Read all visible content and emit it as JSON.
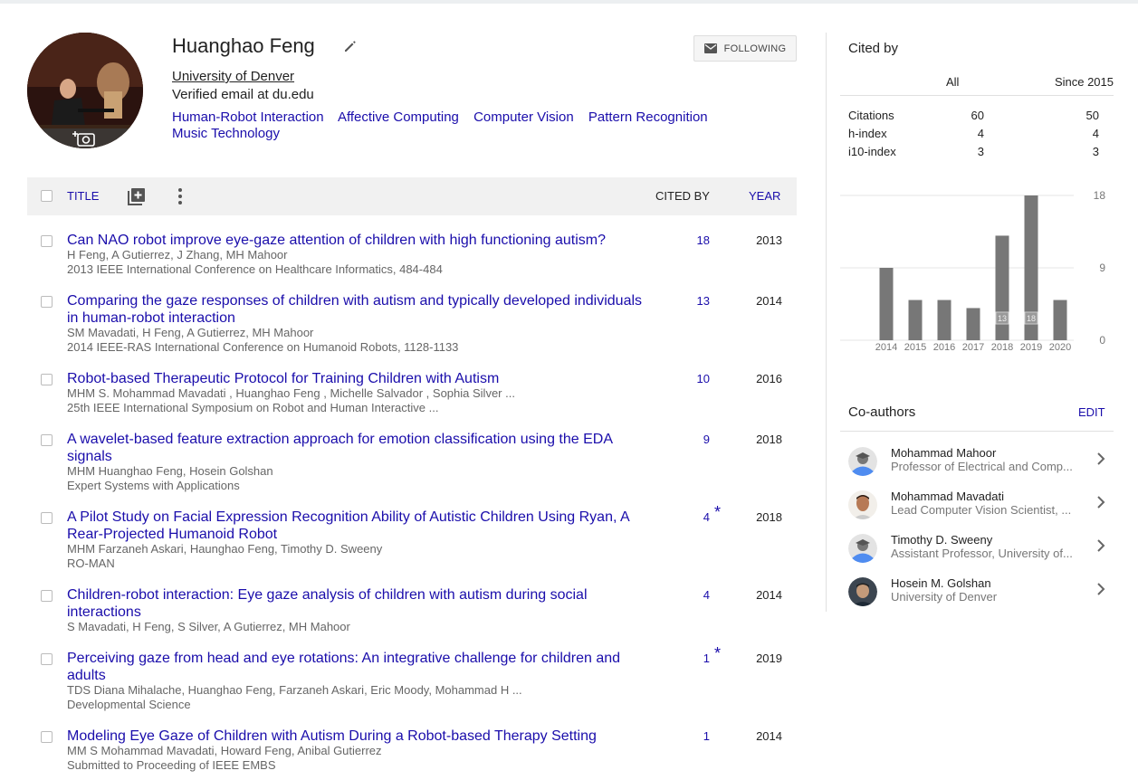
{
  "profile": {
    "name": "Huanghao Feng",
    "affiliation": "University of Denver",
    "email": "Verified email at du.edu",
    "interests": [
      "Human-Robot Interaction",
      "Affective Computing",
      "Computer Vision",
      "Pattern Recognition",
      "Music Technology"
    ],
    "follow_label": "FOLLOWING"
  },
  "table": {
    "headers": {
      "title": "TITLE",
      "cited_by": "CITED BY",
      "year": "YEAR"
    },
    "rows": [
      {
        "title": "Can NAO robot improve eye-gaze attention of children with high functioning autism?",
        "authors": "H Feng, A Gutierrez, J Zhang, MH Mahoor",
        "venue": "2013 IEEE International Conference on Healthcare Informatics, 484-484",
        "cites": "18",
        "star": "",
        "year": "2013"
      },
      {
        "title": "Comparing the gaze responses of children with autism and typically developed individuals in human-robot interaction",
        "authors": "SM Mavadati, H Feng, A Gutierrez, MH Mahoor",
        "venue": "2014 IEEE-RAS International Conference on Humanoid Robots, 1128-1133",
        "cites": "13",
        "star": "",
        "year": "2014"
      },
      {
        "title": "Robot-based Therapeutic Protocol for Training Children with Autism",
        "authors": "MHM S. Mohammad Mavadati , Huanghao Feng , Michelle Salvador , Sophia Silver ...",
        "venue": "25th IEEE International Symposium on Robot and Human Interactive ...",
        "cites": "10",
        "star": "",
        "year": "2016"
      },
      {
        "title": "A wavelet-based feature extraction approach for emotion classification using the EDA signals",
        "authors": "MHM Huanghao Feng, Hosein Golshan",
        "venue": "Expert Systems with Applications",
        "cites": "9",
        "star": "",
        "year": "2018"
      },
      {
        "title": "A Pilot Study on Facial Expression Recognition Ability of Autistic Children Using Ryan, A Rear-Projected Humanoid Robot",
        "authors": "MHM Farzaneh Askari, Haunghao Feng, Timothy D. Sweeny",
        "venue": "RO-MAN",
        "cites": "4",
        "star": "*",
        "year": "2018"
      },
      {
        "title": "Children-robot interaction: Eye gaze analysis of children with autism during social interactions",
        "authors": "S Mavadati, H Feng, S Silver, A Gutierrez, MH Mahoor",
        "venue": "",
        "cites": "4",
        "star": "",
        "year": "2014"
      },
      {
        "title": "Perceiving gaze from head and eye rotations: An integrative challenge for children and adults",
        "authors": "TDS Diana Mihalache, Huanghao Feng, Farzaneh Askari, Eric Moody, Mohammad H ...",
        "venue": "Developmental Science",
        "cites": "1",
        "star": "*",
        "year": "2019"
      },
      {
        "title": "Modeling Eye Gaze of Children with Autism During a Robot-based Therapy Setting",
        "authors": "MM S Mohammad Mavadati, Howard Feng, Anibal Gutierrez",
        "venue": "Submitted to Proceeding of IEEE EMBS",
        "cites": "1",
        "star": "",
        "year": "2014"
      }
    ]
  },
  "cited_by": {
    "heading": "Cited by",
    "col_all": "All",
    "col_since": "Since 2015",
    "rows": [
      {
        "label": "Citations",
        "all": "60",
        "since": "50"
      },
      {
        "label": "h-index",
        "all": "4",
        "since": "4"
      },
      {
        "label": "i10-index",
        "all": "3",
        "since": "3"
      }
    ]
  },
  "chart_data": {
    "type": "bar",
    "categories": [
      "2014",
      "2015",
      "2016",
      "2017",
      "2018",
      "2019",
      "2020"
    ],
    "values": [
      9,
      5,
      5,
      4,
      13,
      18,
      5
    ],
    "yticks": [
      "18",
      "9",
      "0"
    ],
    "ylim": [
      0,
      18
    ],
    "bar_labels": {
      "2018": "13",
      "2019": "18"
    },
    "colors": {
      "bar": "#777777",
      "grid": "#e5e5e5"
    }
  },
  "coauthors": {
    "heading": "Co-authors",
    "edit_label": "EDIT",
    "items": [
      {
        "name": "Mohammad Mahoor",
        "affiliation": "Professor of Electrical and Comp...",
        "avatar": "default"
      },
      {
        "name": "Mohammad Mavadati",
        "affiliation": "Lead Computer Vision Scientist, ...",
        "avatar": "photo"
      },
      {
        "name": "Timothy D. Sweeny",
        "affiliation": "Assistant Professor, University of...",
        "avatar": "default"
      },
      {
        "name": "Hosein M. Golshan",
        "affiliation": "University of Denver",
        "avatar": "photo"
      }
    ]
  }
}
